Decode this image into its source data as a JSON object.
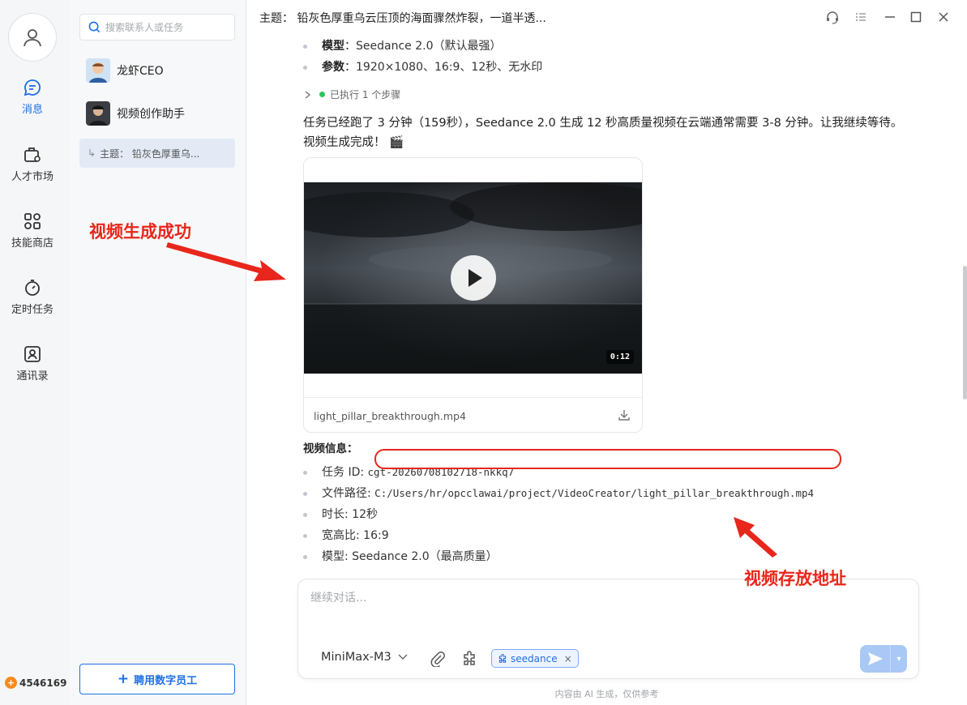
{
  "rail": {
    "items": [
      {
        "label": "消息",
        "icon": "chat-icon",
        "active": true
      },
      {
        "label": "人才市场",
        "icon": "briefcase-icon"
      },
      {
        "label": "技能商店",
        "icon": "grid-icon"
      },
      {
        "label": "定时任务",
        "icon": "timer-icon"
      },
      {
        "label": "通讯录",
        "icon": "contacts-icon"
      }
    ],
    "coins": "4546169"
  },
  "list": {
    "search_placeholder": "搜索联系人或任务",
    "contacts": [
      {
        "name": "龙虾CEO"
      },
      {
        "name": "视频创作助手"
      }
    ],
    "thread": "主题：  铅灰色厚重乌...",
    "hire_button": "聘用数字员工"
  },
  "header": {
    "title": "主题：  铅灰色厚重乌云压顶的海面骤然炸裂，一道半透..."
  },
  "message": {
    "bullets_top": [
      {
        "key": "模型",
        "value": "：Seedance 2.0（默认最强）"
      },
      {
        "key": "参数",
        "value": "：1920×1080、16:9、12秒、无水印"
      }
    ],
    "steps": "已执行 1 个步骤",
    "paragraph": "任务已经跑了 3 分钟（159秒），Seedance 2.0 生成 12 秒高质量视频在云端通常需要 3-8 分钟。让我继续等待。视频生成完成！ 🎬",
    "video": {
      "duration": "0:12",
      "filename": "light_pillar_breakthrough.mp4"
    },
    "info_title": "视频信息：",
    "info": [
      {
        "label": "任务 ID: ",
        "value": "cgt-20260708102718-nkkq7",
        "mono": true
      },
      {
        "label": "文件路径: ",
        "value": "C:/Users/hr/opcclawai/project/VideoCreator/light_pillar_breakthrough.mp4",
        "mono": true
      },
      {
        "label": "时长: ",
        "value": "12秒",
        "mono": false
      },
      {
        "label": "宽高比: ",
        "value": "16:9",
        "mono": false
      },
      {
        "label": "模型: ",
        "value": "Seedance 2.0（最高质量）",
        "mono": false
      }
    ]
  },
  "composer": {
    "placeholder": "继续对话...",
    "model": "MiniMax-M3",
    "chip": "seedance",
    "footer": "内容由 AI 生成，仅供参考"
  },
  "annotations": {
    "left": "视频生成成功",
    "right": "视频存放地址",
    "color": "#e8261b"
  },
  "colors": {
    "accent": "#1e6fe6",
    "annotation": "#e8261b"
  }
}
